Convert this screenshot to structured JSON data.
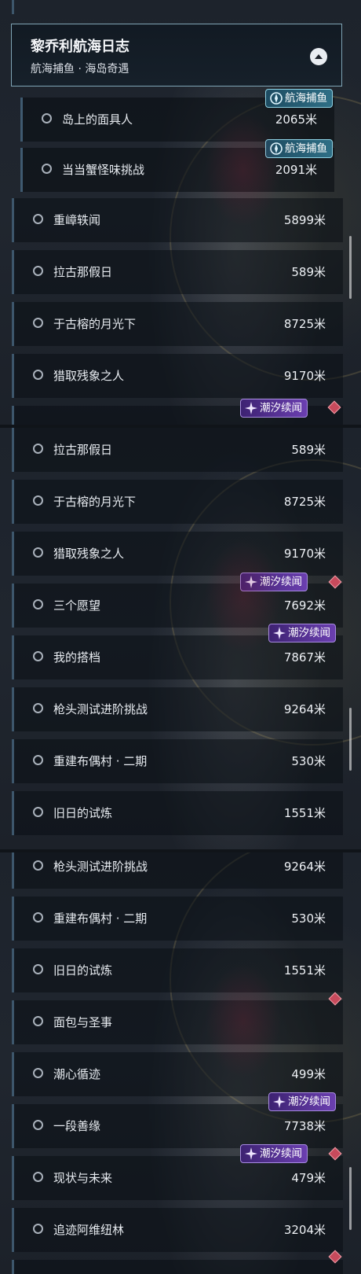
{
  "header": {
    "title": "黎乔利航海日志",
    "subtitle": "航海捕鱼 · 海岛奇遇"
  },
  "tags": {
    "fishing": "航海捕鱼",
    "tide": "潮汐续闻"
  },
  "panel1": {
    "sub_rows": [
      {
        "name": "岛上的面具人",
        "dist": "2065米"
      },
      {
        "name": "当当蟹怪味挑战",
        "dist": "2091米"
      }
    ],
    "rows": [
      {
        "name": "重嶂轶闻",
        "dist": "5899米"
      },
      {
        "name": "拉古那假日",
        "dist": "589米"
      },
      {
        "name": "于古榕的月光下",
        "dist": "8725米"
      },
      {
        "name": "猎取残象之人",
        "dist": "9170米"
      }
    ]
  },
  "panel2": {
    "rows": [
      {
        "name": "拉古那假日",
        "dist": "589米"
      },
      {
        "name": "于古榕的月光下",
        "dist": "8725米"
      },
      {
        "name": "猎取残象之人",
        "dist": "9170米"
      },
      {
        "name": "三个愿望",
        "dist": "7692米"
      },
      {
        "name": "我的搭档",
        "dist": "7867米"
      },
      {
        "name": "枪头测试进阶挑战",
        "dist": "9264米"
      },
      {
        "name": "重建布偶村 · 二期",
        "dist": "530米"
      },
      {
        "name": "旧日的试炼",
        "dist": "1551米"
      }
    ]
  },
  "panel3": {
    "rows": [
      {
        "name": "枪头测试进阶挑战",
        "dist": "9264米"
      },
      {
        "name": "重建布偶村 · 二期",
        "dist": "530米"
      },
      {
        "name": "旧日的试炼",
        "dist": "1551米"
      },
      {
        "name": "面包与圣事",
        "dist": ""
      },
      {
        "name": "潮心循迹",
        "dist": "499米"
      },
      {
        "name": "一段善缘",
        "dist": "7738米"
      },
      {
        "name": "现状与未来",
        "dist": "479米"
      },
      {
        "name": "追迹阿维纽林",
        "dist": "3204米"
      }
    ]
  },
  "colors": {
    "tag_purple": "#6b3fb0",
    "tag_teal": "#2f6f86",
    "diamond": "#c74a5c",
    "row_border": "#3d566b"
  }
}
